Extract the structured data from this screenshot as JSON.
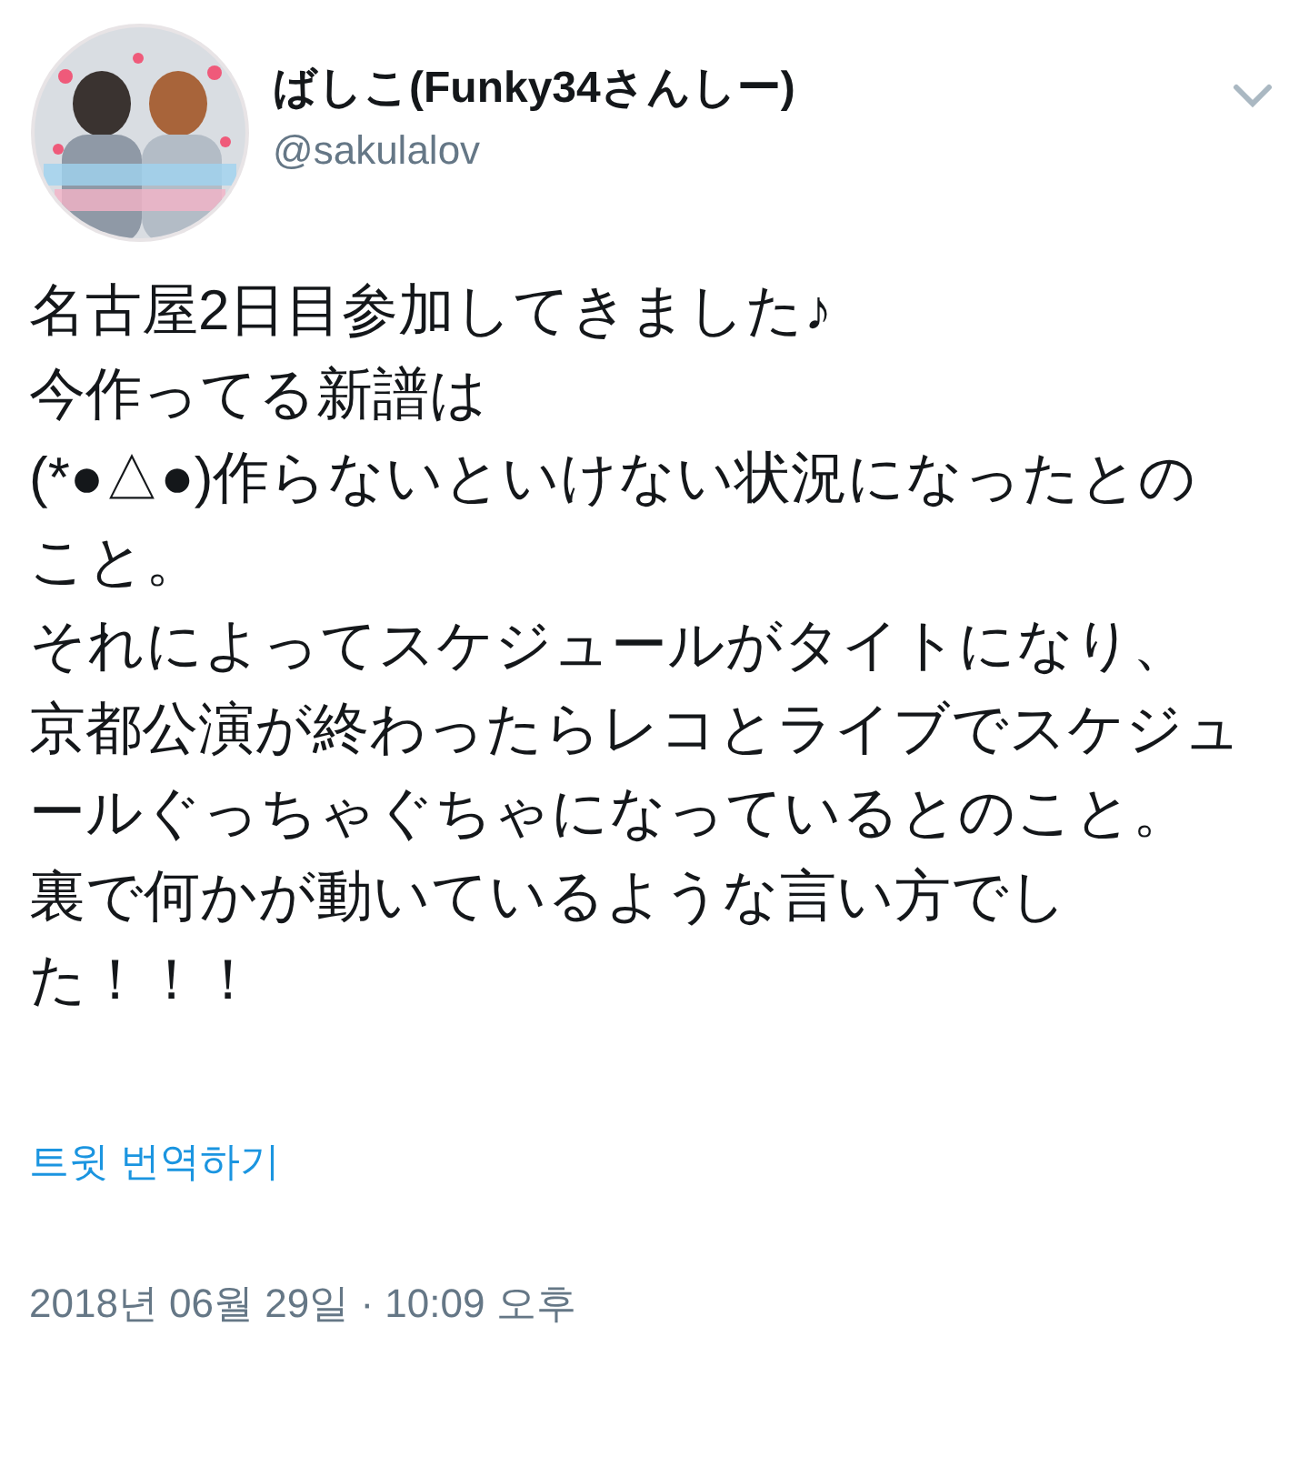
{
  "author": {
    "name": "ばしこ(Funky34さんしー)",
    "handle": "@sakulalov"
  },
  "tweet": {
    "paragraphs": [
      "名古屋2日目参加してきました♪",
      "今作ってる新譜は",
      "(*●△●)作らないといけない状況になったとのこと。",
      "それによってスケジュールがタイトになり、",
      "京都公演が終わったらレコとライブでスケジュールぐっちゃぐちゃになっているとのこと。",
      "裏で何かが動いているような言い方でした！！！"
    ]
  },
  "translate_link": "트윗 번역하기",
  "timestamp": "2018년 06월 29일 · 10:09 오후"
}
